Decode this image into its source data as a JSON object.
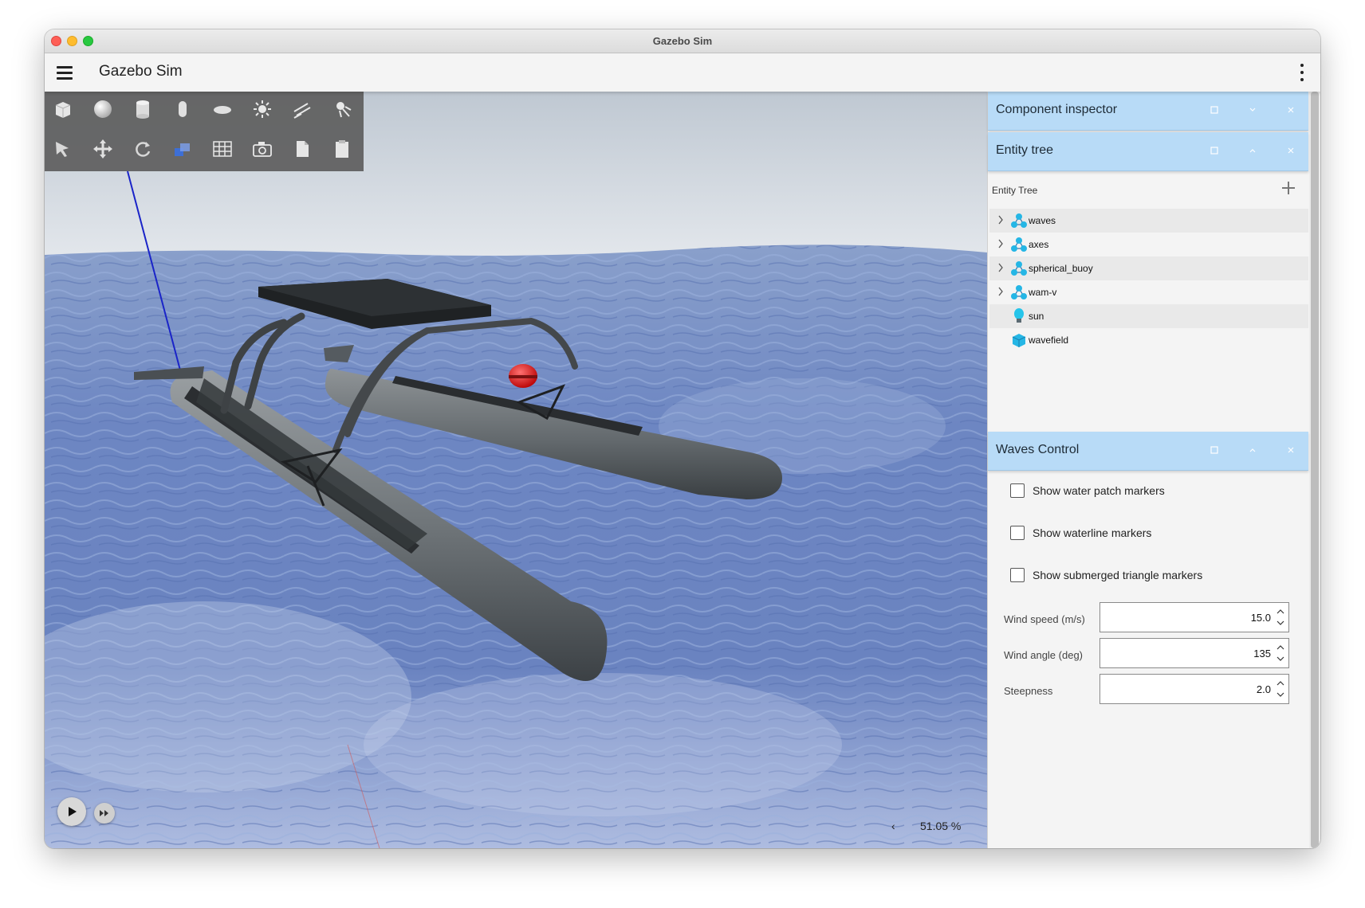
{
  "window": {
    "title": "Gazebo Sim"
  },
  "appbar": {
    "title": "Gazebo Sim"
  },
  "toolbar": {
    "row1": [
      "box-icon",
      "sphere-icon",
      "cylinder-icon",
      "capsule-icon",
      "ellipsoid-icon",
      "sun-icon",
      "directional-light-icon",
      "spot-light-icon"
    ],
    "row2": [
      "select-icon",
      "translate-icon",
      "rotate-icon",
      "scale-icon",
      "grid-icon",
      "camera-icon",
      "copy-icon",
      "paste-icon"
    ]
  },
  "viewport": {
    "rtf_value": "51.05 %"
  },
  "panels": {
    "component_inspector": {
      "title": "Component inspector"
    },
    "entity_tree": {
      "title": "Entity tree",
      "label": "Entity Tree",
      "items": [
        {
          "name": "waves",
          "icon": "model-icon",
          "expandable": true
        },
        {
          "name": "axes",
          "icon": "model-icon",
          "expandable": true
        },
        {
          "name": "spherical_buoy",
          "icon": "model-icon",
          "expandable": true
        },
        {
          "name": "wam-v",
          "icon": "model-icon",
          "expandable": true
        },
        {
          "name": "sun",
          "icon": "light-icon",
          "expandable": false
        },
        {
          "name": "wavefield",
          "icon": "visual-icon",
          "expandable": false
        }
      ]
    },
    "waves_control": {
      "title": "Waves Control",
      "checkboxes": [
        {
          "label": "Show water patch markers",
          "checked": false
        },
        {
          "label": "Show waterline markers",
          "checked": false
        },
        {
          "label": "Show submerged triangle markers",
          "checked": false
        }
      ],
      "fields": [
        {
          "label": "Wind speed (m/s)",
          "value": "15.0"
        },
        {
          "label": "Wind angle (deg)",
          "value": "135"
        },
        {
          "label": "Steepness",
          "value": "2.0"
        }
      ]
    }
  },
  "colors": {
    "panel_header": "#b8dbf7",
    "accent_buoy": "#e01010"
  }
}
